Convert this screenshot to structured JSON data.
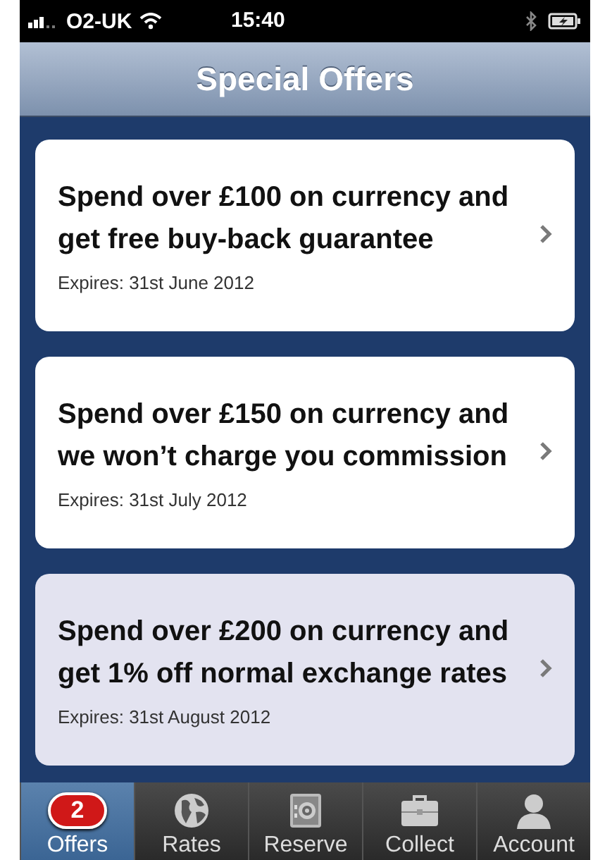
{
  "status_bar": {
    "carrier": "O2-UK",
    "time": "15:40"
  },
  "nav_bar": {
    "title": "Special Offers"
  },
  "offers": [
    {
      "title": "Spend over £100 on currency and get free buy-back guarantee",
      "expires": "Expires: 31st June 2012",
      "selected": false
    },
    {
      "title": "Spend over £150 on currency and we won’t charge you commission",
      "expires": "Expires: 31st July 2012",
      "selected": false
    },
    {
      "title": "Spend over £200 on currency and get 1% off normal exchange rates",
      "expires": "Expires: 31st August 2012",
      "selected": true
    }
  ],
  "tab_bar": [
    {
      "kind": "offers",
      "label": "Offers",
      "badge": "2",
      "selected": true
    },
    {
      "kind": "globe",
      "label": "Rates",
      "selected": false
    },
    {
      "kind": "safe",
      "label": "Reserve",
      "selected": false
    },
    {
      "kind": "briefcase",
      "label": "Collect",
      "selected": false
    },
    {
      "kind": "person",
      "label": "Account",
      "selected": false
    }
  ]
}
